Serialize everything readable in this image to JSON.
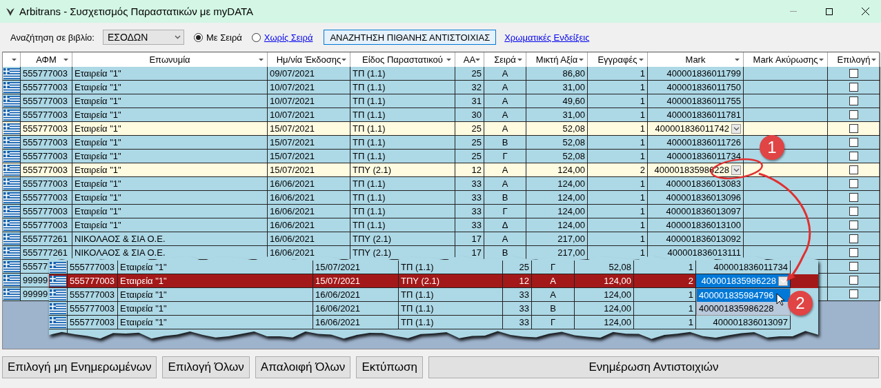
{
  "window": {
    "title": "Arbitrans - Συσχετισμός Παραστατικών με myDATA"
  },
  "toolbar": {
    "book_label": "Αναζήτηση σε βιβλίο:",
    "book_value": "ΕΣΟΔΩΝ",
    "radios": [
      {
        "label": "Με Σειρά",
        "selected": true,
        "kind": "plain"
      },
      {
        "label": "Χωρίς Σειρά",
        "selected": false,
        "kind": "link"
      }
    ],
    "search_button": "ΑΝΑΖΗΤΗΣΗ ΠΙΘΑΝΗΣ ΑΝΤΙΣΤΟΙΧΙΑΣ",
    "legend_link": "Χρωματικές Ενδείξεις"
  },
  "table": {
    "columns": [
      "ΑΦΜ",
      "Επωνυμία",
      "Ημ/νία Έκδοσης",
      "Είδος Παραστατικού",
      "ΑΑ",
      "Σειρά",
      "Μικτή Αξία",
      "Εγγραφές",
      "Mark",
      "Mark Ακύρωσης",
      "Επιλογή"
    ],
    "rows": [
      {
        "afm": "555777003",
        "name": "Εταιρεία \"1\"",
        "date": "09/07/2021",
        "type": "ΤΠ (1.1)",
        "aa": "25",
        "series": "Α",
        "amount": "86,80",
        "entries": "1",
        "mark": "400001836011799",
        "highlighted": false,
        "dropdown": false,
        "checked": false
      },
      {
        "afm": "555777003",
        "name": "Εταιρεία \"1\"",
        "date": "10/07/2021",
        "type": "ΤΠ (1.1)",
        "aa": "32",
        "series": "Α",
        "amount": "31,00",
        "entries": "1",
        "mark": "400001836011750",
        "highlighted": false,
        "dropdown": false,
        "checked": false
      },
      {
        "afm": "555777003",
        "name": "Εταιρεία \"1\"",
        "date": "10/07/2021",
        "type": "ΤΠ (1.1)",
        "aa": "31",
        "series": "Α",
        "amount": "49,60",
        "entries": "1",
        "mark": "400001836011755",
        "highlighted": false,
        "dropdown": false,
        "checked": false
      },
      {
        "afm": "555777003",
        "name": "Εταιρεία \"1\"",
        "date": "10/07/2021",
        "type": "ΤΠ (1.1)",
        "aa": "30",
        "series": "Α",
        "amount": "31,00",
        "entries": "1",
        "mark": "400001836011781",
        "highlighted": false,
        "dropdown": false,
        "checked": false
      },
      {
        "afm": "555777003",
        "name": "Εταιρεία \"1\"",
        "date": "15/07/2021",
        "type": "ΤΠ (1.1)",
        "aa": "25",
        "series": "Α",
        "amount": "52,08",
        "entries": "1",
        "mark": "400001836011742",
        "highlighted": true,
        "dropdown": true,
        "checked": false
      },
      {
        "afm": "555777003",
        "name": "Εταιρεία \"1\"",
        "date": "15/07/2021",
        "type": "ΤΠ (1.1)",
        "aa": "25",
        "series": "Β",
        "amount": "52,08",
        "entries": "1",
        "mark": "400001836011726",
        "highlighted": false,
        "dropdown": false,
        "checked": false
      },
      {
        "afm": "555777003",
        "name": "Εταιρεία \"1\"",
        "date": "15/07/2021",
        "type": "ΤΠ (1.1)",
        "aa": "25",
        "series": "Γ",
        "amount": "52,08",
        "entries": "1",
        "mark": "400001836011734",
        "highlighted": false,
        "dropdown": false,
        "checked": false
      },
      {
        "afm": "555777003",
        "name": "Εταιρεία \"1\"",
        "date": "15/07/2021",
        "type": "ΤΠΥ (2.1)",
        "aa": "12",
        "series": "Α",
        "amount": "124,00",
        "entries": "2",
        "mark": "400001835986228",
        "highlighted": true,
        "dropdown": true,
        "checked": false
      },
      {
        "afm": "555777003",
        "name": "Εταιρεία \"1\"",
        "date": "16/06/2021",
        "type": "ΤΠ (1.1)",
        "aa": "33",
        "series": "Α",
        "amount": "124,00",
        "entries": "1",
        "mark": "400001836013083",
        "highlighted": false,
        "dropdown": false,
        "checked": false
      },
      {
        "afm": "555777003",
        "name": "Εταιρεία \"1\"",
        "date": "16/06/2021",
        "type": "ΤΠ (1.1)",
        "aa": "33",
        "series": "Β",
        "amount": "124,00",
        "entries": "1",
        "mark": "400001836013096",
        "highlighted": false,
        "dropdown": false,
        "checked": false
      },
      {
        "afm": "555777003",
        "name": "Εταιρεία \"1\"",
        "date": "16/06/2021",
        "type": "ΤΠ (1.1)",
        "aa": "33",
        "series": "Γ",
        "amount": "124,00",
        "entries": "1",
        "mark": "400001836013097",
        "highlighted": false,
        "dropdown": false,
        "checked": false
      },
      {
        "afm": "555777003",
        "name": "Εταιρεία \"1\"",
        "date": "16/06/2021",
        "type": "ΤΠ (1.1)",
        "aa": "33",
        "series": "Δ",
        "amount": "124,00",
        "entries": "1",
        "mark": "400001836013100",
        "highlighted": false,
        "dropdown": false,
        "checked": false
      },
      {
        "afm": "555777261",
        "name": "ΝΙΚΟΛΑΟΣ & ΣΙΑ Ο.Ε.",
        "date": "16/06/2021",
        "type": "ΤΠΥ (2.1)",
        "aa": "17",
        "series": "Α",
        "amount": "217,00",
        "entries": "1",
        "mark": "400001836013092",
        "highlighted": false,
        "dropdown": false,
        "checked": false
      },
      {
        "afm": "555777261",
        "name": "ΝΙΚΟΛΑΟΣ & ΣΙΑ Ο.Ε.",
        "date": "16/06/2021",
        "type": "ΤΠΥ (2.1)",
        "aa": "17",
        "series": "Β",
        "amount": "217,00",
        "entries": "1",
        "mark": "400001836013111",
        "highlighted": false,
        "dropdown": false,
        "checked": false
      },
      {
        "afm": "55577",
        "checked": false
      },
      {
        "afm": "99999",
        "checked": false
      },
      {
        "afm": "99999",
        "checked": false
      }
    ]
  },
  "inset": {
    "rows": [
      {
        "afm": "555777003",
        "name": "Εταιρεία \"1\"",
        "date": "15/07/2021",
        "type": "ΤΠ (1.1)",
        "aa": "25",
        "series": "Γ",
        "amount": "52,08",
        "entries": "1",
        "mark": "400001836011734",
        "selected": false,
        "dropdown": false
      },
      {
        "afm": "555777003",
        "name": "Εταιρεία \"1\"",
        "date": "15/07/2021",
        "type": "ΤΠΥ (2.1)",
        "aa": "12",
        "series": "Α",
        "amount": "124,00",
        "entries": "2",
        "mark": "400001835986228",
        "selected": true,
        "dropdown": true
      },
      {
        "afm": "555777003",
        "name": "Εταιρεία \"1\"",
        "date": "16/06/2021",
        "type": "ΤΠ (1.1)",
        "aa": "33",
        "series": "Α",
        "amount": "124,00",
        "entries": "1",
        "selected": false,
        "dropdown": false
      },
      {
        "afm": "555777003",
        "name": "Εταιρεία \"1\"",
        "date": "16/06/2021",
        "type": "ΤΠ (1.1)",
        "aa": "33",
        "series": "Β",
        "amount": "124,00",
        "entries": "1",
        "selected": false,
        "dropdown": false
      },
      {
        "afm": "555777003",
        "name": "Εταιρεία \"1\"",
        "date": "16/06/2021",
        "type": "ΤΠ (1.1)",
        "aa": "33",
        "series": "Γ",
        "amount": "124,00",
        "entries": "1",
        "mark": "400001836013097",
        "selected": false,
        "dropdown": false
      }
    ],
    "options": [
      {
        "label": "400001835984796",
        "selected": true
      },
      {
        "label": "400001835986228",
        "selected": false
      }
    ]
  },
  "annotations": [
    {
      "label": "1"
    },
    {
      "label": "2"
    }
  ],
  "buttons": [
    "Επιλογή μη Ενημερωμένων",
    "Επιλογή Όλων",
    "Απαλοιφή Όλων",
    "Εκτύπωση",
    "Ενημέρωση Αντιστοιχιών"
  ]
}
